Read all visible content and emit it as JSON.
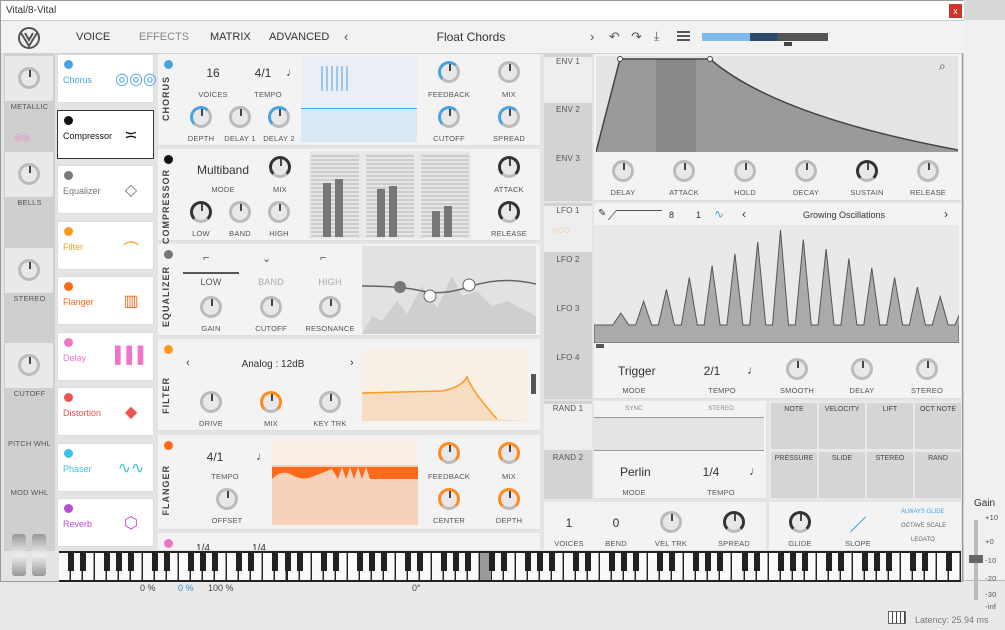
{
  "window": {
    "title": "Vital/8-Vital",
    "close_glyph": "x"
  },
  "tabs": [
    "VOICE",
    "EFFECTS",
    "MATRIX",
    "ADVANCED"
  ],
  "preset": {
    "name": "Float Chords"
  },
  "left_column": {
    "labels": [
      "METALLIC",
      "BELLS",
      "STEREO",
      "CUTOFF",
      "PITCH WHL",
      "MOD WHL"
    ]
  },
  "effects": [
    {
      "name": "Chorus",
      "color": "#4aa3e0"
    },
    {
      "name": "Compressor",
      "color": "#111111"
    },
    {
      "name": "Equalizer",
      "color": "#777777"
    },
    {
      "name": "Filter",
      "color": "#ff9a1f"
    },
    {
      "name": "Flanger",
      "color": "#ff6a1a"
    },
    {
      "name": "Delay",
      "color": "#f075c8"
    },
    {
      "name": "Distortion",
      "color": "#f05050"
    },
    {
      "name": "Phaser",
      "color": "#3bc0e8"
    },
    {
      "name": "Reverb",
      "color": "#b64fd6"
    }
  ],
  "chorus": {
    "title": "CHORUS",
    "voices": "16",
    "tempo": "4/1",
    "labels": {
      "voices": "VOICES",
      "tempo": "TEMPO",
      "feedback": "FEEDBACK",
      "mix": "MIX",
      "depth": "DEPTH",
      "delay1": "DELAY 1",
      "delay2": "DELAY 2",
      "cutoff": "CUTOFF",
      "spread": "SPREAD"
    }
  },
  "compressor": {
    "title": "COMPRESSOR",
    "mode": "Multiband",
    "labels": {
      "mode": "MODE",
      "mix": "MIX",
      "attack": "ATTACK",
      "low": "LOW",
      "band": "BAND",
      "high": "HIGH",
      "release": "RELEASE"
    }
  },
  "equalizer": {
    "title": "EQUALIZER",
    "bands": [
      "LOW",
      "BAND",
      "HIGH"
    ],
    "labels": {
      "gain": "GAIN",
      "cutoff": "CUTOFF",
      "resonance": "RESONANCE"
    }
  },
  "filter": {
    "title": "FILTER",
    "model": "Analog : 12dB",
    "labels": {
      "drive": "DRIVE",
      "mix": "MIX",
      "keytrk": "KEY TRK"
    }
  },
  "flanger": {
    "title": "FLANGER",
    "tempo": "4/1",
    "labels": {
      "tempo": "TEMPO",
      "offset": "OFFSET",
      "feedback": "FEEDBACK",
      "mix": "MIX",
      "center": "CENTER",
      "depth": "DEPTH"
    }
  },
  "delay_peek": {
    "left": "1/4",
    "right": "1/4"
  },
  "envelopes": {
    "tabs": [
      "ENV 1",
      "ENV 2",
      "ENV 3"
    ],
    "labels": [
      "DELAY",
      "ATTACK",
      "HOLD",
      "DECAY",
      "SUSTAIN",
      "RELEASE"
    ]
  },
  "lfos": {
    "tabs": [
      "LFO 1",
      "LFO 2",
      "LFO 3",
      "LFO 4"
    ],
    "grid_x": "8",
    "grid_y": "1",
    "shape_name": "Growing Oscillations",
    "mode": "Trigger",
    "tempo": "2/1",
    "labels": {
      "mode": "MODE",
      "tempo": "TEMPO",
      "smooth": "SMOOTH",
      "delay": "DELAY",
      "stereo": "STEREO"
    }
  },
  "randoms": {
    "tabs": [
      "RAND 1",
      "RAND 2"
    ],
    "sync_label": "SYNC",
    "stereo_label": "STEREO",
    "mode": "Perlin",
    "tempo": "1/4",
    "labels": {
      "mode": "MODE",
      "tempo": "TEMPO"
    }
  },
  "mod_sources": [
    "NOTE",
    "VELOCITY",
    "LIFT",
    "OCT NOTE",
    "PRESSURE",
    "SLIDE",
    "STEREO",
    "RAND"
  ],
  "voice": {
    "voices": "1",
    "bend": "0",
    "labels": {
      "voices": "VOICES",
      "bend": "BEND",
      "veltrk": "VEL TRK",
      "spread": "SPREAD",
      "glide": "GLIDE",
      "slope": "SLOPE"
    },
    "glide_options": [
      "ALWAYS GLIDE",
      "OCTAVE SCALE",
      "LEGATO"
    ]
  },
  "host_bg": {
    "values": [
      "0 %",
      "0 %",
      "100 %",
      "0°"
    ],
    "gain_label": "Gain",
    "db_marks": [
      "+10",
      "+0",
      "-10",
      "-20",
      "-30",
      "-inf"
    ],
    "latency": "Latency: 25.94 ms"
  },
  "colors": {
    "accent": "#4aa3e0",
    "orange": "#ff8a1f",
    "panel": "#f3f3f3"
  }
}
